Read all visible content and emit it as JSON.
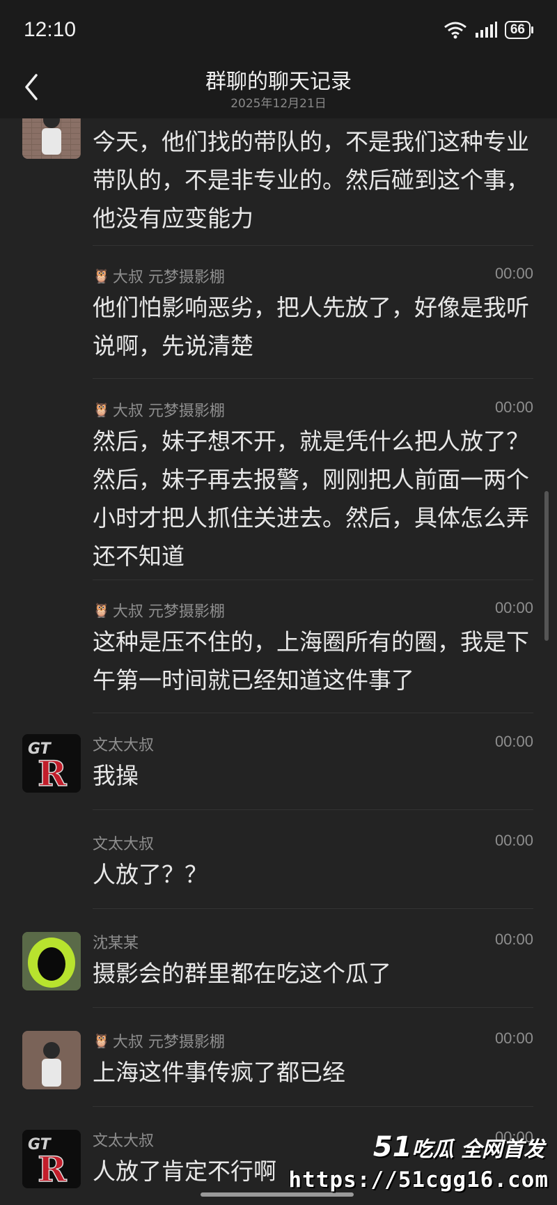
{
  "status": {
    "time": "12:10",
    "battery": "66"
  },
  "nav": {
    "title": "群聊的聊天记录",
    "subtitle": "2025年12月21日"
  },
  "messages": [
    {
      "sender": "",
      "time": "",
      "text": "今天，他们找的带队的，不是我们这种专业带队的，不是非专业的。然后碰到这个事，他没有应变能力",
      "avatar": "photo-man"
    },
    {
      "sender": "大叔 元梦摄影棚",
      "time": "00:00",
      "text": "他们怕影响恶劣，把人先放了，好像是我听说啊，先说清楚"
    },
    {
      "sender": "大叔 元梦摄影棚",
      "time": "00:00",
      "text": "然后，妹子想不开，就是凭什么把人放了？然后，妹子再去报警，刚刚把人前面一两个小时才把人抓住关进去。然后，具体怎么弄还不知道"
    },
    {
      "sender": "大叔 元梦摄影棚",
      "time": "00:00",
      "text": "这种是压不住的，上海圈所有的圈，我是下午第一时间就已经知道这件事了"
    },
    {
      "sender": "文太大叔",
      "time": "00:00",
      "text": "我操",
      "avatar": "gtr-logo"
    },
    {
      "sender": "文太大叔",
      "time": "00:00",
      "text": "人放了？？"
    },
    {
      "sender": "沈某某",
      "time": "00:00",
      "text": "摄影会的群里都在吃这个瓜了",
      "avatar": "green-ring"
    },
    {
      "sender": "大叔 元梦摄影棚",
      "time": "00:00",
      "text": "上海这件事传疯了都已经",
      "avatar": "photo-man"
    },
    {
      "sender": "文太大叔",
      "time": "00:00",
      "text": "人放了肯定不行啊",
      "avatar": "gtr-logo"
    }
  ],
  "watermark": {
    "logo_num": "51",
    "logo_text": "吃瓜 全网首发",
    "url": "https://51cgg16.com"
  }
}
